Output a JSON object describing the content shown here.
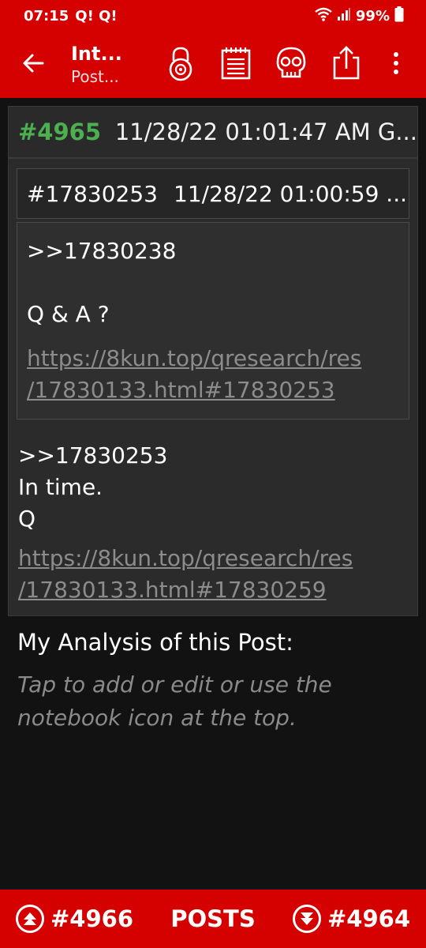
{
  "status_bar": {
    "time": "07:15",
    "notifications": "Q! Q!",
    "battery": "99%"
  },
  "app_bar": {
    "title": "Int...",
    "subtitle": "Post...",
    "icons": [
      "arrow-back-icon",
      "lock-icon",
      "notebook-icon",
      "skull-icon",
      "share-icon",
      "more-vert-icon"
    ]
  },
  "post": {
    "number": "#4965",
    "datetime": "11/28/22 01:01:47 AM G...",
    "quoted": {
      "id": "#17830253",
      "datetime": "11/28/22 01:00:59 ...",
      "reply_to": ">>17830238",
      "text": "Q & A ?",
      "link_line1": "https://8kun.top/qresearch/res",
      "link_line2": "/17830133.html#17830253"
    },
    "reply_to": ">>17830253",
    "line1": "In time.",
    "line2": "Q",
    "link_line1": "https://8kun.top/qresearch/res",
    "link_line2": "/17830133.html#17830259"
  },
  "analysis": {
    "label": "My Analysis of this Post:",
    "placeholder": "Tap to add or edit or use the notebook icon at the top."
  },
  "bottom_bar": {
    "next": "#4966",
    "center": "POSTS",
    "prev": "#4964"
  },
  "colors": {
    "accent": "#d50000",
    "post_number": "#4caf50",
    "background": "#121212"
  }
}
